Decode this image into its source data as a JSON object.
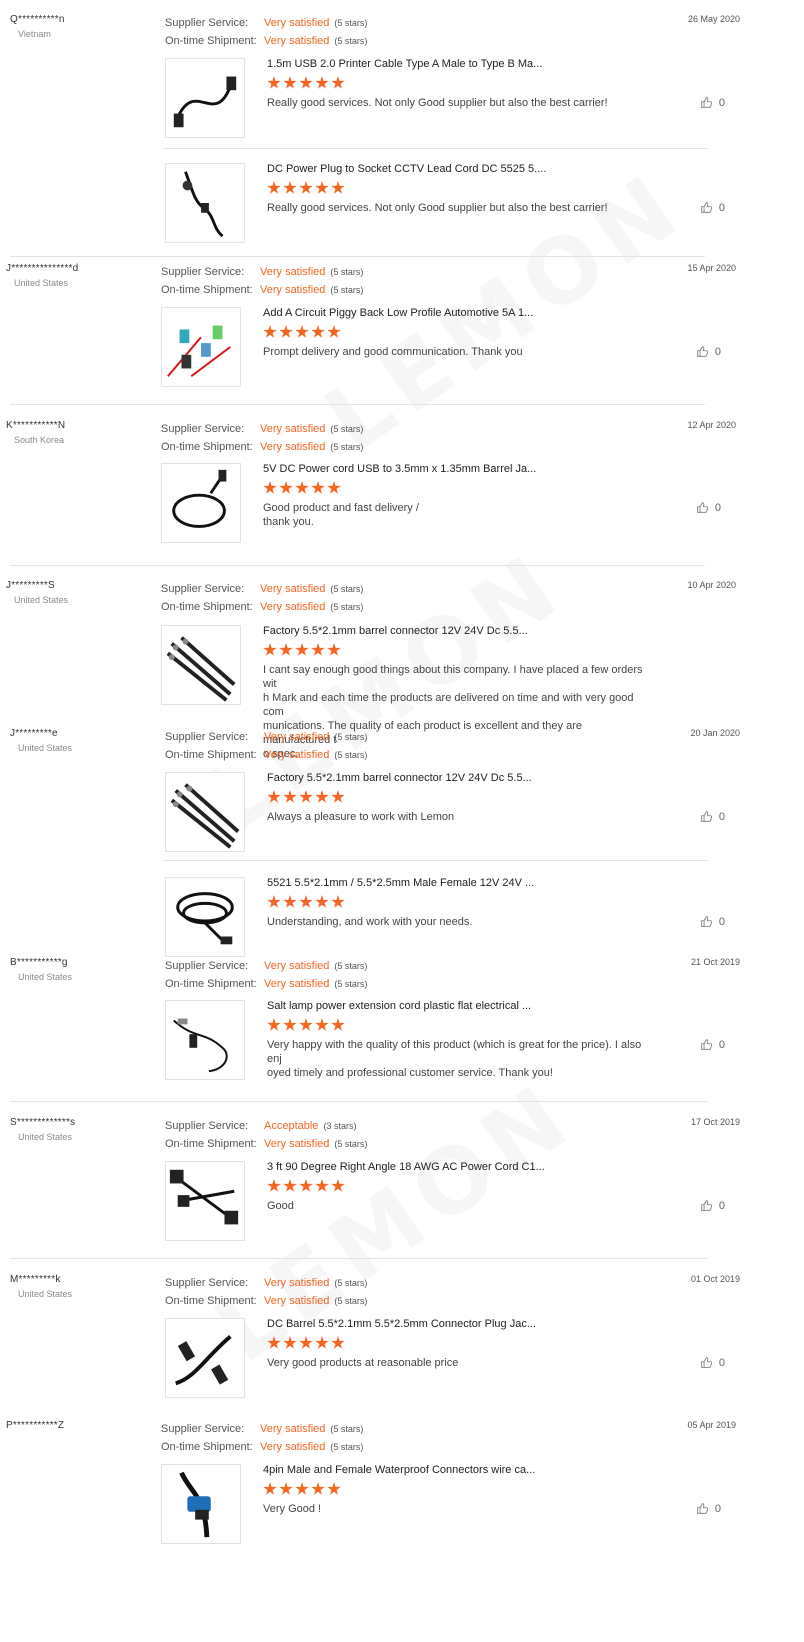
{
  "watermark": "LEMON",
  "labels": {
    "supplier_service": "Supplier Service:",
    "on_time_shipment": "On-time Shipment:"
  },
  "colors": {
    "accent": "#f26522",
    "divider": "#e3e3e3"
  },
  "reviews": [
    {
      "name": "Q**********n",
      "country": "Vietnam",
      "date": "26 May 2020",
      "supplier": {
        "value": "Very satisfied",
        "stars": "(5 stars)"
      },
      "shipment": {
        "value": "Very satisfied",
        "stars": "(5 stars)"
      },
      "products": [
        {
          "title": "1.5m USB 2.0 Printer Cable Type A Male to Type B Ma...",
          "rating": 5,
          "comment": "Really good services. Not only Good supplier but also the best carrier!",
          "likes": "0",
          "icon": "usb-cable-icon"
        },
        {
          "title": "DC Power Plug to Socket CCTV Lead Cord DC 5525 5....",
          "rating": 5,
          "comment": "Really good services. Not only Good supplier but also the best carrier!",
          "likes": "0",
          "icon": "dc-cord-icon"
        }
      ]
    },
    {
      "name": "J***************d",
      "country": "United States",
      "date": "15 Apr 2020",
      "supplier": {
        "value": "Very satisfied",
        "stars": "(5 stars)"
      },
      "shipment": {
        "value": "Very satisfied",
        "stars": "(5 stars)"
      },
      "products": [
        {
          "title": "Add A Circuit Piggy Back Low Profile Automotive 5A 1...",
          "rating": 5,
          "comment": "Prompt delivery and good communication.  Thank you",
          "likes": "0",
          "icon": "fuse-tap-icon"
        }
      ]
    },
    {
      "name": "K***********N",
      "country": "South Korea",
      "date": "12 Apr 2020",
      "supplier": {
        "value": "Very satisfied",
        "stars": "(5 stars)"
      },
      "shipment": {
        "value": "Very satisfied",
        "stars": "(5 stars)"
      },
      "products": [
        {
          "title": "5V DC Power cord USB to 3.5mm x 1.35mm Barrel Ja...",
          "rating": 5,
          "comment": "Good product and fast delivery /\nthank you.",
          "likes": "0",
          "icon": "usb-barrel-cord-icon"
        }
      ]
    },
    {
      "name": "J*********S",
      "country": "United States",
      "date": "10 Apr 2020",
      "supplier": {
        "value": "Very satisfied",
        "stars": "(5 stars)"
      },
      "shipment": {
        "value": "Very satisfied",
        "stars": "(5 stars)"
      },
      "products": [
        {
          "title": "Factory 5.5*2.1mm barrel connector 12V 24V Dc 5.5...",
          "rating": 5,
          "comment": "I cant say enough good things about this company. I have placed a few orders wit\nh Mark and each time the products are delivered on time and with very good com\nmunications. The quality of each product is excellent and they are manufactured t\no spec.",
          "likes": "",
          "icon": "barrel-connector-icon"
        }
      ]
    },
    {
      "name": "J*********e",
      "country": "United States",
      "date": "20 Jan 2020",
      "supplier": {
        "value": "Very satisfied",
        "stars": "(5 stars)"
      },
      "shipment": {
        "value": "Very satisfied",
        "stars": "(5 stars)"
      },
      "products": [
        {
          "title": "Factory 5.5*2.1mm barrel connector 12V 24V Dc 5.5...",
          "rating": 5,
          "comment": "Always a pleasure to work with Lemon",
          "likes": "0",
          "icon": "barrel-connector-icon"
        },
        {
          "title": "5521 5.5*2.1mm / 5.5*2.5mm Male Female 12V 24V ...",
          "rating": 5,
          "comment": "Understanding, and work with your needs.",
          "likes": "0",
          "icon": "extension-cable-icon"
        }
      ]
    },
    {
      "name": "B***********g",
      "country": "United States",
      "date": "21 Oct 2019",
      "supplier": {
        "value": "Very satisfied",
        "stars": "(5 stars)"
      },
      "shipment": {
        "value": "Very satisfied",
        "stars": "(5 stars)"
      },
      "products": [
        {
          "title": "Salt lamp power extension cord plastic flat electrical ...",
          "rating": 5,
          "comment": "Very happy with the quality of this product (which is great for the price). I also enj\noyed timely and professional customer service. Thank you!",
          "likes": "0",
          "icon": "lamp-cord-icon"
        }
      ]
    },
    {
      "name": "S*************s",
      "country": "United States",
      "date": "17 Oct 2019",
      "supplier": {
        "value": "Acceptable",
        "stars": "(3 stars)"
      },
      "shipment": {
        "value": "Very satisfied",
        "stars": "(5 stars)"
      },
      "products": [
        {
          "title": "3 ft 90 Degree Right Angle 18 AWG AC Power Cord C1...",
          "rating": 5,
          "comment": "Good",
          "likes": "0",
          "icon": "ac-power-cord-icon"
        }
      ]
    },
    {
      "name": "M*********k",
      "country": "United States",
      "date": "01 Oct 2019",
      "supplier": {
        "value": "Very satisfied",
        "stars": "(5 stars)"
      },
      "shipment": {
        "value": "Very satisfied",
        "stars": "(5 stars)"
      },
      "products": [
        {
          "title": "DC Barrel 5.5*2.1mm 5.5*2.5mm Connector Plug Jac...",
          "rating": 5,
          "comment": "Very good products at reasonable price",
          "likes": "0",
          "icon": "dc-barrel-plug-icon"
        }
      ]
    },
    {
      "name": "P***********Z",
      "country": "",
      "date": "05 Apr 2019",
      "supplier": {
        "value": "Very satisfied",
        "stars": "(5 stars)"
      },
      "shipment": {
        "value": "Very satisfied",
        "stars": "(5 stars)"
      },
      "products": [
        {
          "title": "4pin Male and Female Waterproof Connectors wire ca...",
          "rating": 5,
          "comment": "Very Good !",
          "likes": "0",
          "icon": "waterproof-connector-icon"
        }
      ]
    }
  ]
}
